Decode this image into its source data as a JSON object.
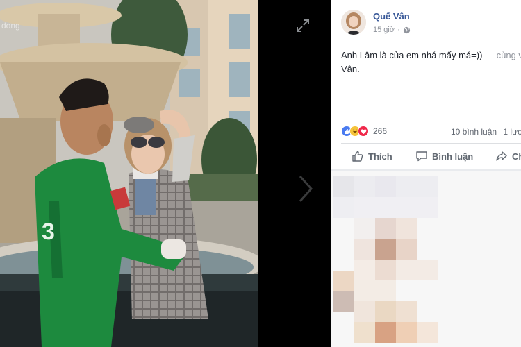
{
  "viewer": {
    "watermark": "dong",
    "expand_icon": "expand-icon",
    "next_icon": "chevron-right-icon"
  },
  "post": {
    "author": "Quế Vân",
    "time": "15 giờ",
    "privacy_icon": "globe-icon",
    "text": "Anh Lâm là của em nhá mấy má=))",
    "with_text": " — cùng v",
    "continuation": "Vân.",
    "reactions": {
      "icons": [
        "like-reaction-icon",
        "haha-reaction-icon",
        "love-reaction-icon"
      ],
      "count": "266"
    },
    "comments_count": "10 bình luận",
    "shares_count": "1 lượ"
  },
  "actions": {
    "like": "Thích",
    "comment": "Bình luận",
    "share": "Ch"
  },
  "colors": {
    "link": "#385898",
    "muted": "#90949c",
    "action": "#606770",
    "like_blue": "#4a7bf0",
    "love_red": "#f0284a",
    "haha_yellow": "#f5c33b"
  }
}
